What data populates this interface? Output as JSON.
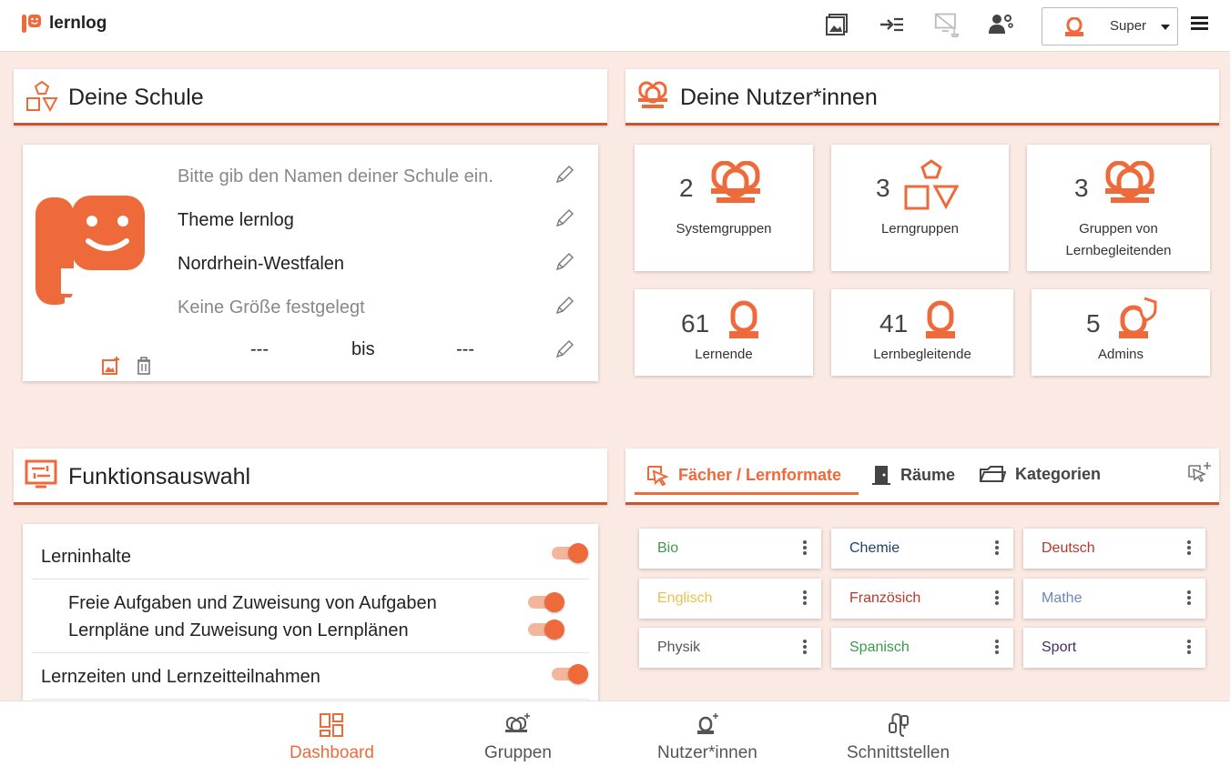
{
  "app": {
    "name": "lernlog"
  },
  "topbar": {
    "icons": [
      "gallery-icon",
      "login-arrow-icon",
      "screen-disabled-icon",
      "admin-users-icon"
    ],
    "user_name": "Super"
  },
  "school": {
    "title": "Deine Schule",
    "name_placeholder": "Bitte gib den Namen deiner Schule ein.",
    "theme": "Theme lernlog",
    "state": "Nordrhein-Westfalen",
    "size": "Keine Größe festgelegt",
    "range_from": "---",
    "range_sep": "bis",
    "range_to": "---"
  },
  "users": {
    "title": "Deine Nutzer*innen",
    "tiles": [
      {
        "count": "2",
        "label": "Systemgruppen"
      },
      {
        "count": "3",
        "label": "Lerngruppen"
      },
      {
        "count": "3",
        "label": "Gruppen von Lernbegleitenden"
      },
      {
        "count": "61",
        "label": "Lernende"
      },
      {
        "count": "41",
        "label": "Lernbegleitende"
      },
      {
        "count": "5",
        "label": "Admins"
      }
    ]
  },
  "functions": {
    "title": "Funktionsauswahl",
    "items": [
      {
        "label": "Lerninhalte",
        "enabled": true
      },
      {
        "label": "Freie Aufgaben und Zuweisung von Aufgaben",
        "enabled": true
      },
      {
        "label": "Lernpläne und Zuweisung von Lernplänen",
        "enabled": true
      },
      {
        "label": "Lernzeiten und Lernzeitteilnahmen",
        "enabled": true
      }
    ]
  },
  "tabs": {
    "items": [
      {
        "label": "Fächer / Lernformate",
        "active": true
      },
      {
        "label": "Räume",
        "active": false
      },
      {
        "label": "Kategorien",
        "active": false
      }
    ]
  },
  "subjects": [
    {
      "name": "Bio",
      "color": "#3a9a4c"
    },
    {
      "name": "Chemie",
      "color": "#1e3f66"
    },
    {
      "name": "Deutsch",
      "color": "#b8372c"
    },
    {
      "name": "Englisch",
      "color": "#e8c24a"
    },
    {
      "name": "Französich",
      "color": "#b8372c"
    },
    {
      "name": "Mathe",
      "color": "#6b86b8"
    },
    {
      "name": "Physik",
      "color": "#555555"
    },
    {
      "name": "Spanisch",
      "color": "#3a9a4c"
    },
    {
      "name": "Sport",
      "color": "#4a2a6a"
    }
  ],
  "bottom_nav": {
    "items": [
      {
        "label": "Dashboard",
        "active": true
      },
      {
        "label": "Gruppen",
        "active": false
      },
      {
        "label": "Nutzer*innen",
        "active": false
      },
      {
        "label": "Schnittstellen",
        "active": false
      }
    ]
  },
  "colors": {
    "accent": "#ee6a3a",
    "accent_dark": "#c8552e",
    "background": "#fbe9e3"
  }
}
